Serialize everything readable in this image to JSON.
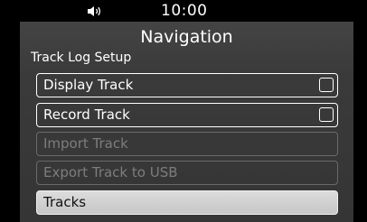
{
  "statusbar": {
    "volume_icon": "speaker-volume-icon",
    "time": "10:00"
  },
  "header": {
    "title": "Navigation"
  },
  "section": {
    "label": "Track Log Setup"
  },
  "menu": {
    "items": [
      {
        "label": "Display Track",
        "enabled": true,
        "checkbox": true,
        "checked": false
      },
      {
        "label": "Record Track",
        "enabled": true,
        "checkbox": true,
        "checked": false
      },
      {
        "label": "Import Track",
        "enabled": false
      },
      {
        "label": "Export Track to USB",
        "enabled": false
      },
      {
        "label": "Tracks",
        "enabled": true,
        "selected": true
      }
    ]
  },
  "colors": {
    "background": "#000000",
    "panel": "#3c3c3c",
    "text": "#ffffff",
    "disabled_text": "#7d7d7d",
    "selected_fill": "#d2d2d2"
  }
}
